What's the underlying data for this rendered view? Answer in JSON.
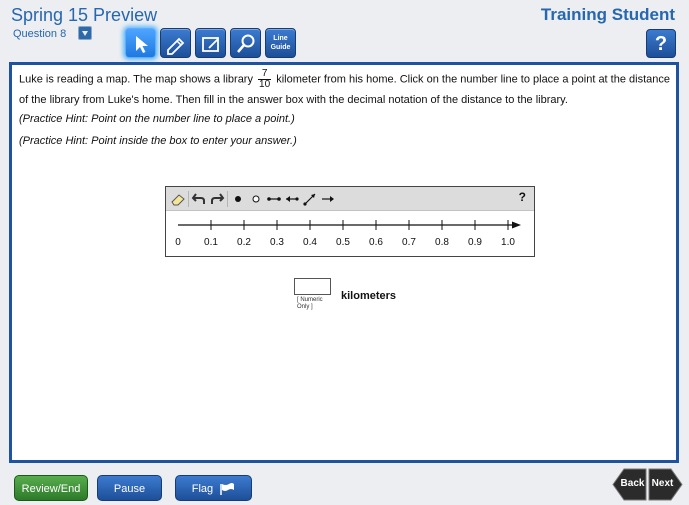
{
  "header": {
    "title": "Spring 15 Preview",
    "question_label": "Question 8",
    "student_name": "Training Student",
    "tools": [
      {
        "icon": "pointer-icon",
        "active": true
      },
      {
        "icon": "highlighter-icon",
        "active": false
      },
      {
        "icon": "notepad-icon",
        "active": false
      },
      {
        "icon": "magnifier-icon",
        "active": false
      },
      {
        "label": "Line Guide",
        "active": false
      }
    ],
    "help_label": "?"
  },
  "question": {
    "text_before": "Luke is reading a map. The map shows a library",
    "fraction_numerator": "7",
    "fraction_denominator": "10",
    "text_after": "kilometer from his home. Click on the number line to place a point at the distance of the library from Luke's home. Then fill in the answer box with the decimal notation of the distance to the library.",
    "hint1": "(Practice Hint: Point on the number line to place a point.)",
    "hint2": "(Practice Hint: Point inside the box to enter your answer.)"
  },
  "number_line": {
    "toolbar": {
      "tools": [
        "eraser-icon",
        "undo-icon",
        "redo-icon",
        "point-icon",
        "open-point-icon",
        "segment-icon",
        "left-ray-icon",
        "line-icon",
        "right-ray-icon"
      ],
      "help_label": "?"
    },
    "ticks": [
      "0",
      "0.1",
      "0.2",
      "0.3",
      "0.4",
      "0.5",
      "0.6",
      "0.7",
      "0.8",
      "0.9",
      "1.0"
    ]
  },
  "answer": {
    "value": "",
    "hint_line1": "[ Numeric",
    "hint_line2": "Only ]",
    "unit": "kilometers"
  },
  "footer": {
    "review_label": "Review/End Test",
    "pause_label": "Pause",
    "flag_label": "Flag",
    "back_label": "Back",
    "next_label": "Next"
  },
  "colors": {
    "accent": "#2667b0",
    "panel_border": "#1d53a0",
    "green_button": "#3c8f37",
    "blue_button": "#1d4f98"
  }
}
